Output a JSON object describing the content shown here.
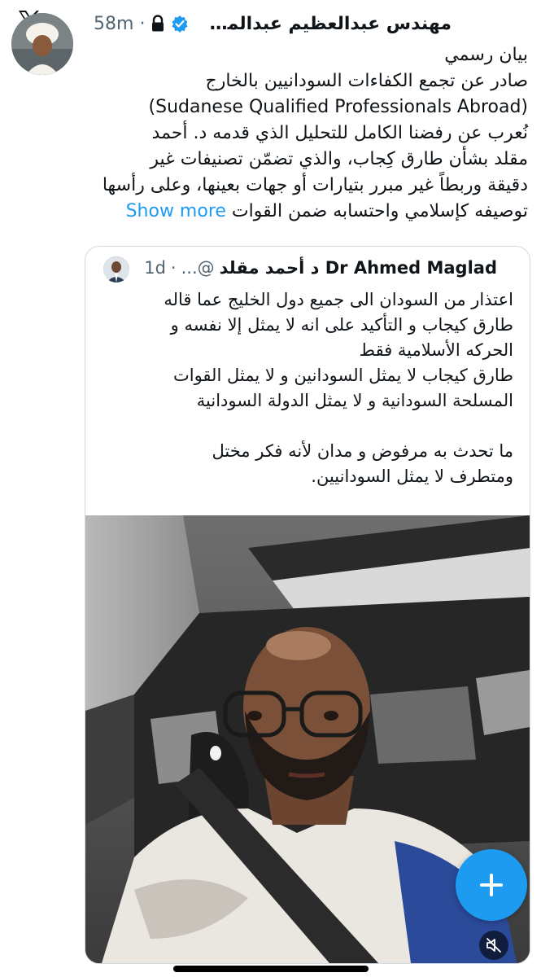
{
  "header": {
    "author_name": "مهندس عبدالعظيم عبدالمطلب...",
    "timestamp": "58m",
    "separator": "·"
  },
  "tweet": {
    "lines": [
      "بيان رسمي",
      "صادر عن تجمع الكفاءات  السودانيين بالخارج",
      "(Sudanese Qualified Professionals Abroad)",
      "نُعرب عن رفضنا الكامل للتحليل الذي قدمه د. أحمد",
      "مقلد بشأن طارق كِجاب، والذي تضمّن تصنيفات غير",
      "دقيقة وربطاً غير مبرر بتيارات أو جهات بعينها، وعلى رأسها",
      "توصيفه كإسلامي واحتسابه ضمن القوات"
    ],
    "show_more": "Show more"
  },
  "quote": {
    "name": "Dr Ahmed Maglad د أحمد مقلد",
    "handle": "@...",
    "separator": "·",
    "time": "1d",
    "lines": [
      "اعتذار من السودان الى جميع دول الخليج عما قاله",
      "طارق كيجاب و التأكيد على انه لا يمثل إلا نفسه و",
      "الحركه الأسلامية فقط",
      "طارق كيجاب لا يمثل السودانين و لا يمثل القوات",
      "المسلحة السودانية و لا يمثل الدولة السودانية",
      "",
      "ما تحدث به مرفوض و مدان لأنه فكر مختل",
      "ومتطرف لا يمثل السودانيين."
    ]
  },
  "colors": {
    "accent": "#1d9bf0",
    "text": "#0f1419",
    "secondary": "#536471",
    "border": "#cfd9de"
  },
  "icons": {
    "logo": "x-logo-icon",
    "verified": "verified-badge-icon",
    "lock": "lock-icon",
    "compose": "plus-icon",
    "mute": "speaker-muted-icon"
  }
}
